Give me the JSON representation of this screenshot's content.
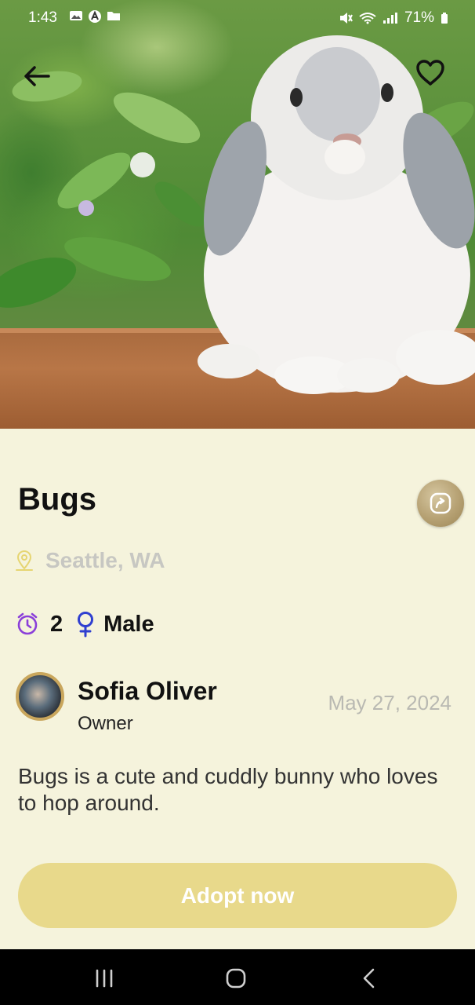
{
  "status_bar": {
    "time": "1:43",
    "battery": "71%"
  },
  "pet": {
    "name": "Bugs",
    "location": "Seattle, WA",
    "age": "2",
    "gender": "Male",
    "description": "Bugs is a cute and cuddly bunny who loves to hop around."
  },
  "owner": {
    "name": "Sofia Oliver",
    "role": "Owner",
    "date": "May 27, 2024"
  },
  "actions": {
    "adopt_label": "Adopt now"
  },
  "colors": {
    "background": "#f5f3dc",
    "accent": "#e8d98b",
    "icon_purple": "#8b3fd9",
    "location_icon": "#e6d572"
  },
  "icons": {
    "back": "arrow-left-icon",
    "favorite": "heart-outline-icon",
    "share": "share-icon",
    "location": "location-pin-icon",
    "age": "alarm-clock-icon",
    "gender": "female-symbol-icon"
  }
}
